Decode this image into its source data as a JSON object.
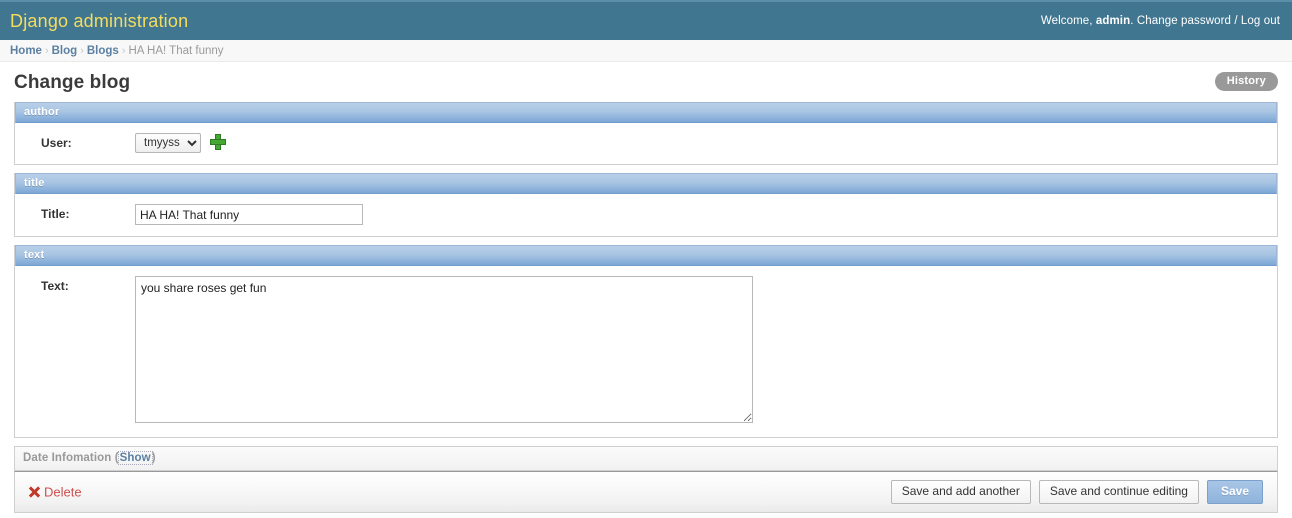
{
  "header": {
    "site_title": "Django administration",
    "welcome_prefix": "Welcome,",
    "username": "admin",
    "separator_dot": ".",
    "change_password": "Change password",
    "slash": "/",
    "logout": "Log out"
  },
  "breadcrumbs": {
    "items": [
      {
        "label": "Home",
        "is_link": true
      },
      {
        "label": "Blog",
        "is_link": true
      },
      {
        "label": "Blogs",
        "is_link": true
      },
      {
        "label": "HA HA! That funny",
        "is_link": false
      }
    ],
    "separator": "›"
  },
  "page": {
    "title": "Change blog",
    "history_label": "History"
  },
  "fieldsets": [
    {
      "legend": "author",
      "rows": [
        {
          "label": "User:",
          "type": "select",
          "value": "tmyyss",
          "options": [
            "tmyyss"
          ],
          "add_icon": "plus-icon"
        }
      ]
    },
    {
      "legend": "title",
      "rows": [
        {
          "label": "Title:",
          "type": "text",
          "value": "HA HA! That funny",
          "placeholder": ""
        }
      ]
    },
    {
      "legend": "text",
      "rows": [
        {
          "label": "Text:",
          "type": "textarea",
          "value": "you share roses get fun",
          "placeholder": ""
        }
      ]
    }
  ],
  "collapsed_fieldset": {
    "legend": "Date Infomation",
    "open_paren": "(",
    "toggle_label": "Show",
    "close_paren": ")"
  },
  "submit_row": {
    "delete_label": "Delete",
    "delete_icon": "x-icon",
    "save_add_another": "Save and add another",
    "save_continue": "Save and continue editing",
    "save": "Save"
  },
  "colors": {
    "header_bg": "#417690",
    "brand_text": "#f5dd5d",
    "fieldset_header": "#7da7d6",
    "link": "#5b80a3",
    "delete": "#cc5050",
    "save_button": "#8fb3dc",
    "history_button": "#999999",
    "add_icon_green": "#44a832"
  }
}
